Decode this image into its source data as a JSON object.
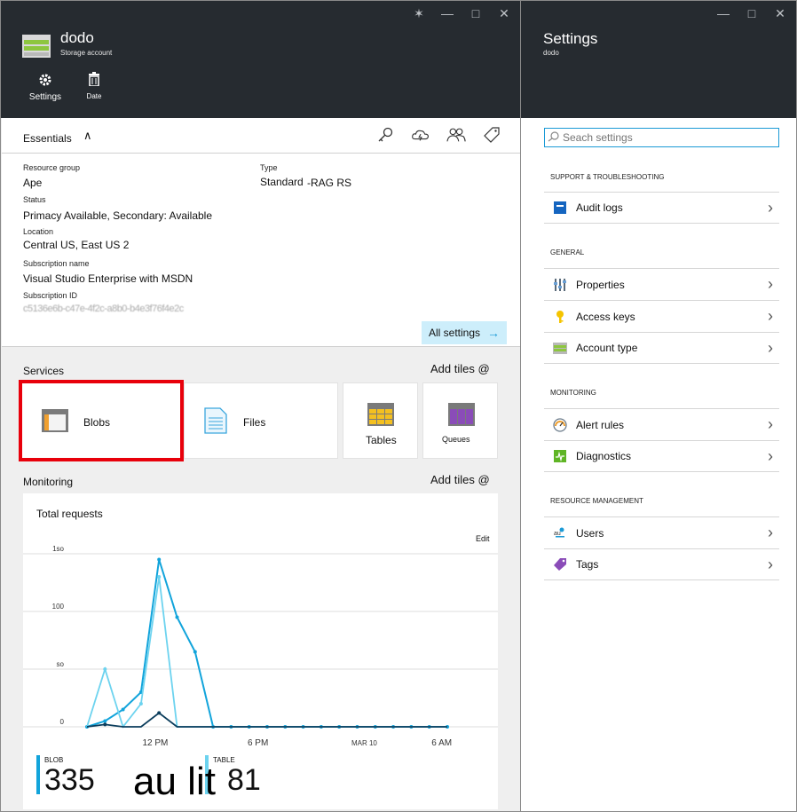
{
  "left_blade": {
    "title": "dodo",
    "subtitle": "Storage account",
    "commands": [
      {
        "label": "Settings",
        "icon": "gear-icon"
      },
      {
        "label": "Date",
        "icon": "trash-icon"
      }
    ],
    "window_controls": {
      "pin": "✶",
      "minimize": "—",
      "maximize": "□",
      "close": "✕"
    },
    "essentials": {
      "title": "Essentials",
      "chevron": "∧",
      "resource_group_label": "Resource group",
      "resource_group_value": "Ape",
      "status_label": "Status",
      "status_value": "Primacy Available, Secondary: Available",
      "location_label": "Location",
      "location_value": "Central US, East US 2",
      "subscription_name_label": "Subscription name",
      "subscription_name_value": "Visual Studio Enterprise with MSDN",
      "subscription_id_label": "Subscription ID",
      "subscription_id_value": "c5136e6b-c47e-4f2c-a8b0-b4e3f76f4e2c",
      "type_label": "Type",
      "type_value_a": "Standard",
      "type_value_b": "-RAG RS",
      "all_settings": "All settings",
      "all_settings_arrow": "→"
    },
    "services": {
      "label": "Services",
      "add_tiles": "Add tiles @",
      "tiles": [
        "Blobs",
        "Files",
        "Tables",
        "Queues"
      ]
    },
    "monitoring": {
      "label": "Monitoring",
      "add_tiles": "Add tiles @",
      "tile_title": "Total requests",
      "edit": "Edit",
      "metrics": [
        {
          "label": "BLOB",
          "value": "335"
        },
        {
          "label": "TABLE",
          "value": "81"
        }
      ],
      "overlay_text": "au lit"
    }
  },
  "chart_data": {
    "type": "line",
    "title": "Total requests",
    "xlabel": "",
    "ylabel": "",
    "y_tick_labels": [
      "0",
      "so",
      "100",
      "1so"
    ],
    "x_tick_labels": [
      "12 PM",
      "6 PM",
      "MAR 10",
      "6 AM"
    ],
    "ylim": [
      0,
      150
    ],
    "grid": true,
    "x_hours": [
      0,
      1,
      2,
      3,
      4,
      5,
      6,
      7,
      8,
      9,
      10,
      11,
      12,
      13,
      14,
      15,
      16,
      17,
      18,
      19,
      20
    ],
    "series": [
      {
        "color": "#12a4db",
        "values": [
          0,
          5,
          15,
          30,
          145,
          95,
          65,
          0,
          0,
          0,
          0,
          0,
          0,
          0,
          0,
          0,
          0,
          0,
          0,
          0,
          0
        ]
      },
      {
        "color": "#6dd3ef",
        "values": [
          0,
          50,
          0,
          20,
          130,
          0,
          0,
          0,
          0,
          0,
          0,
          0,
          0,
          0,
          0,
          0,
          0,
          0,
          0,
          0,
          0
        ]
      },
      {
        "color": "#0b3d5c",
        "values": [
          0,
          2,
          0,
          0,
          12,
          0,
          0,
          0,
          0,
          0,
          0,
          0,
          0,
          0,
          0,
          0,
          0,
          0,
          0,
          0,
          0
        ]
      }
    ]
  },
  "right_blade": {
    "title": "Settings",
    "subtitle": "dodo",
    "window_controls": {
      "minimize": "—",
      "maximize": "□",
      "close": "✕"
    },
    "search_placeholder": "Seach settings",
    "groups": [
      {
        "label": "SUPPORT & TROUBLESHOOTING",
        "items": [
          {
            "label": "Audit logs",
            "icon": "audit-logs-icon"
          }
        ]
      },
      {
        "label": "GENERAL",
        "items": [
          {
            "label": "Properties",
            "icon": "properties-icon"
          },
          {
            "label": "Access keys",
            "icon": "key-icon"
          },
          {
            "label": "Account type",
            "icon": "account-type-icon"
          }
        ]
      },
      {
        "label": "MONITORING",
        "items": [
          {
            "label": "Alert rules",
            "icon": "alert-rules-icon"
          },
          {
            "label": "Diagnostics",
            "icon": "diagnostics-icon"
          }
        ]
      },
      {
        "label": "RESOURCE MANAGEMENT",
        "items": [
          {
            "label": "Users",
            "icon": "users-icon"
          },
          {
            "label": "Tags",
            "icon": "tag-icon"
          }
        ]
      }
    ],
    "chevron": "›"
  },
  "colors": {
    "header_bg": "#262b30",
    "accent": "#1b9ad6",
    "highlight": "#e8000b"
  }
}
